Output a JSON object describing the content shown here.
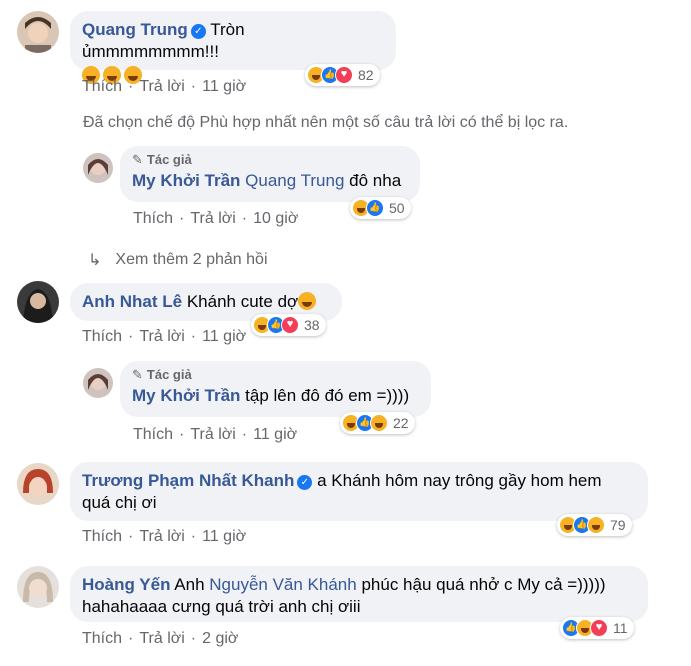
{
  "actions_labels": {
    "like": "Thích",
    "reply": "Trả lời"
  },
  "author_badge": "Tác giả",
  "filter_note": "Đã chọn chế độ Phù hợp nhất nên một số câu trả lời có thể bị lọc ra.",
  "more_replies": "Xem thêm 2 phản hồi",
  "comments": [
    {
      "name": "Quang Trung",
      "verified": true,
      "text": "Tròn ủmmmmmmmm!!!",
      "time": "11 giờ",
      "reactions": [
        "haha",
        "like",
        "love"
      ],
      "count": "82"
    },
    {
      "name": "My Khởi Trần",
      "mention": "Quang Trung",
      "text": "đô nha",
      "time": "10 giờ",
      "reactions": [
        "haha",
        "like"
      ],
      "count": "50"
    },
    {
      "name": "Anh Nhat Lê",
      "text": "Khánh cute dợ",
      "time": "11 giờ",
      "reactions": [
        "haha",
        "like",
        "love"
      ],
      "count": "38"
    },
    {
      "name": "My Khởi Trần",
      "text": "tập lên đô đó em =))))",
      "time": "11 giờ",
      "reactions": [
        "haha",
        "like",
        "care"
      ],
      "count": "22"
    },
    {
      "name": "Trương Phạm Nhất Khanh",
      "verified": true,
      "text": "a Khánh hôm nay trông gầy hom hem",
      "text2": "quá chị ơi",
      "time": "11 giờ",
      "reactions": [
        "haha",
        "like",
        "care"
      ],
      "count": "79"
    },
    {
      "name": "Hoàng Yến",
      "text_pre": "Anh",
      "mention": "Nguyễn Văn Khánh",
      "text": "phúc hậu quá nhở c My cả =)))))",
      "text2": "hahahaaaa cưng quá trời anh chị ơiii",
      "time": "2 giờ",
      "reactions": [
        "like",
        "haha",
        "love"
      ],
      "count": "11"
    }
  ],
  "colors": {
    "link": "#385898",
    "muted": "#65676b",
    "bubble": "#f0f2f5"
  }
}
